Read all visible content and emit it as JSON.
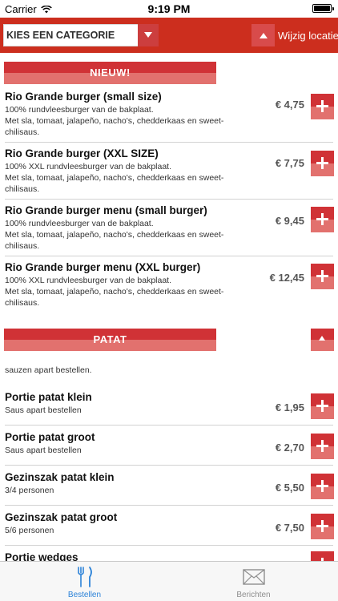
{
  "status_bar": {
    "carrier": "Carrier",
    "time": "9:19 PM"
  },
  "header": {
    "category_select": {
      "label": "KIES EEN CATEGORIE"
    },
    "location_button": {
      "label": "Wijzig locatie"
    }
  },
  "sections": [
    {
      "title": "NIEUW!",
      "items": [
        {
          "name": "Rio Grande burger (small size)",
          "desc": "100% rundvleesburger van de bakplaat.\nMet sla, tomaat, jalapeño, nacho's, chedderkaas en sweet-chilisaus.",
          "price": "€ 4,75"
        },
        {
          "name": "Rio Grande burger (XXL SIZE)",
          "desc": "100% XXL rundvleesburger van de bakplaat.\nMet sla, tomaat, jalapeño, nacho's, chedderkaas en sweet-chilisaus.",
          "price": "€ 7,75"
        },
        {
          "name": "Rio Grande burger menu (small burger)",
          "desc": "100% rundvleesburger van de bakplaat.\nMet sla, tomaat, jalapeño, nacho's, chedderkaas en sweet-chilisaus.",
          "price": "€ 9,45"
        },
        {
          "name": "Rio Grande burger menu (XXL burger)",
          "desc": "100% XXL rundvleesburger van de bakplaat.\nMet sla, tomaat, jalapeño, nacho's, chedderkaas en sweet-chilisaus.",
          "price": "€ 12,45"
        }
      ]
    },
    {
      "title": "PATAT",
      "note": "sauzen apart bestellen.",
      "items": [
        {
          "name": "Portie patat klein",
          "desc": "Saus apart bestellen",
          "price": "€ 1,95"
        },
        {
          "name": "Portie patat groot",
          "desc": "Saus apart bestellen",
          "price": "€ 2,70"
        },
        {
          "name": "Gezinszak patat klein",
          "desc": "3/4 personen",
          "price": "€ 5,50"
        },
        {
          "name": "Gezinszak patat groot",
          "desc": "5/6 personen",
          "price": "€ 7,50"
        },
        {
          "name": "Portie wedges",
          "desc": "",
          "price": ""
        }
      ]
    }
  ],
  "tab_bar": {
    "tabs": [
      {
        "label": "Bestellen",
        "icon": "fork-knife-icon",
        "active": true
      },
      {
        "label": "Berichten",
        "icon": "envelope-icon",
        "active": false
      }
    ]
  },
  "colors": {
    "accent": "#cc2e1e",
    "button_top": "#d03236",
    "button_bottom": "#e2716e",
    "tab_active": "#2b82d8"
  }
}
